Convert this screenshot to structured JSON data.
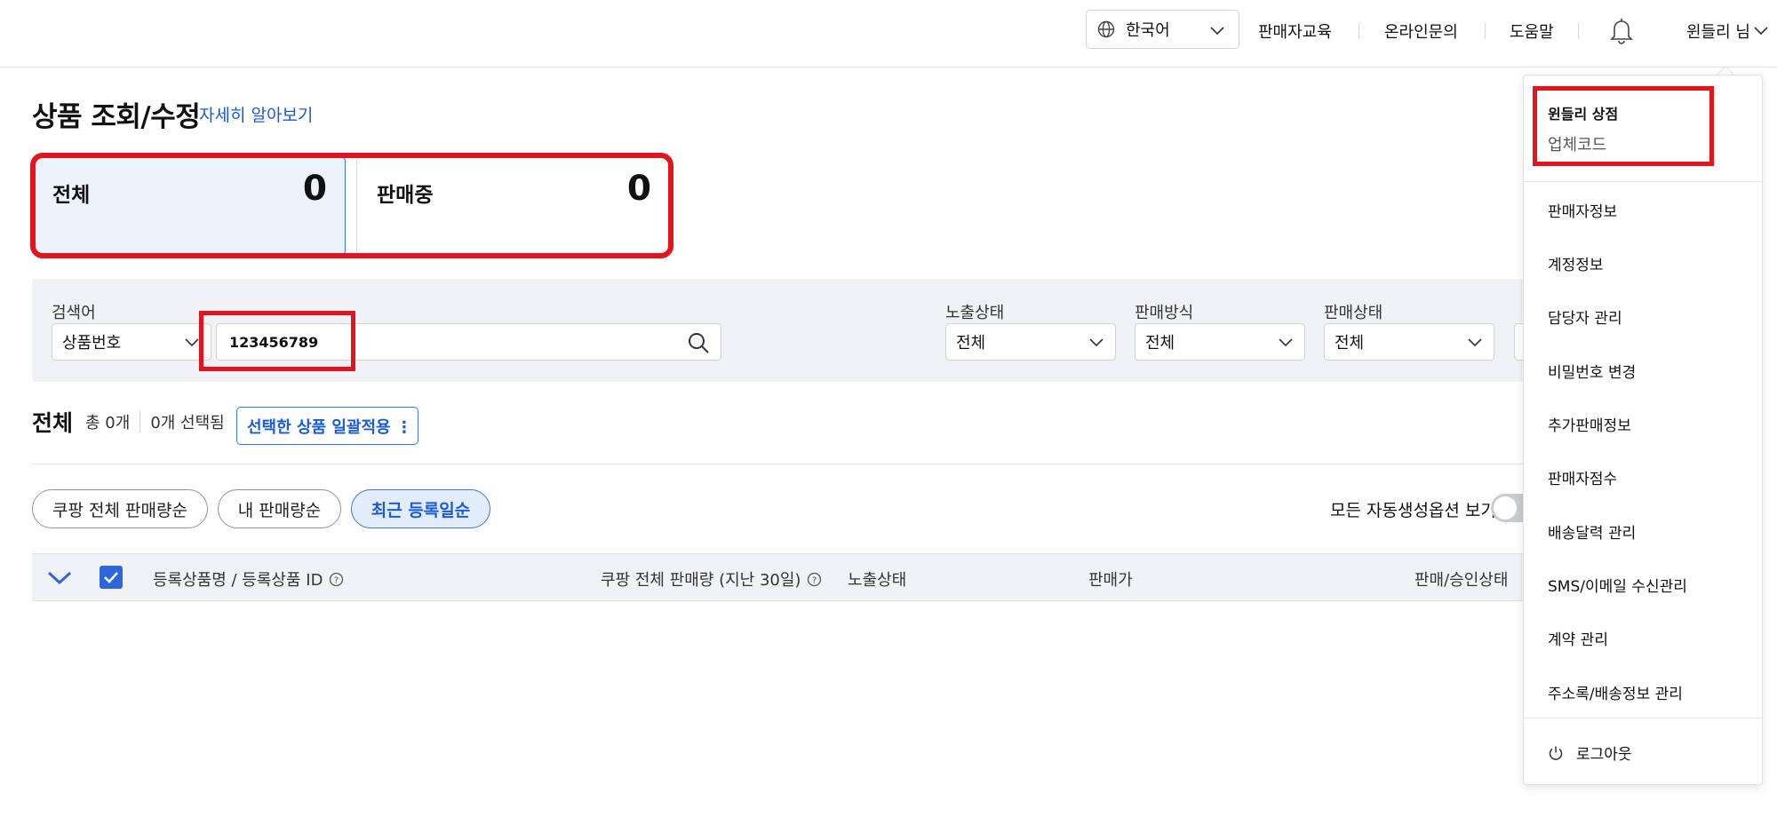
{
  "topbar": {
    "language": "한국어",
    "links": [
      "판매자교육",
      "온라인문의",
      "도움말"
    ],
    "user": "윈들리 님"
  },
  "page": {
    "title": "상품 조회/수정",
    "learn_more": "자세히 알아보기"
  },
  "summary": [
    {
      "label": "전체",
      "count": "0"
    },
    {
      "label": "판매중",
      "count": "0"
    }
  ],
  "filters": {
    "keyword_label": "검색어",
    "keyword_type": "상품번호",
    "keyword_value": "123456789",
    "exposure_label": "노출상태",
    "exposure_value": "전체",
    "method_label": "판매방식",
    "method_value": "전체",
    "status_label": "판매상태",
    "status_value": "전체"
  },
  "list": {
    "title": "전체",
    "total": "총 0개",
    "selected": "0개 선택됨",
    "batch_button": "선택한 상품 일괄적용 ⋮"
  },
  "sort": [
    "쿠팡 전체 판매량순",
    "내 판매량순",
    "최근 등록일순"
  ],
  "auto_option": "모든 자동생성옵션 보기",
  "table_headers": [
    "등록상품명 / 등록상품 ID",
    "쿠팡 전체 판매량 (지난 30일)",
    "노출상태",
    "판매가",
    "판매/승인상태"
  ],
  "menu": {
    "shop_name": "윈들리 상점",
    "shop_code": "업체코드",
    "items": [
      "판매자정보",
      "계정정보",
      "담당자 관리",
      "비밀번호 변경",
      "추가판매정보",
      "판매자점수",
      "배송달력 관리",
      "SMS/이메일 수신관리",
      "계약 관리",
      "주소록/배송정보 관리"
    ],
    "logout": "로그아웃"
  },
  "colors": {
    "accent": "#1a5bd8",
    "highlight": "#e5131d",
    "filter_bg": "#f0f2f5"
  }
}
